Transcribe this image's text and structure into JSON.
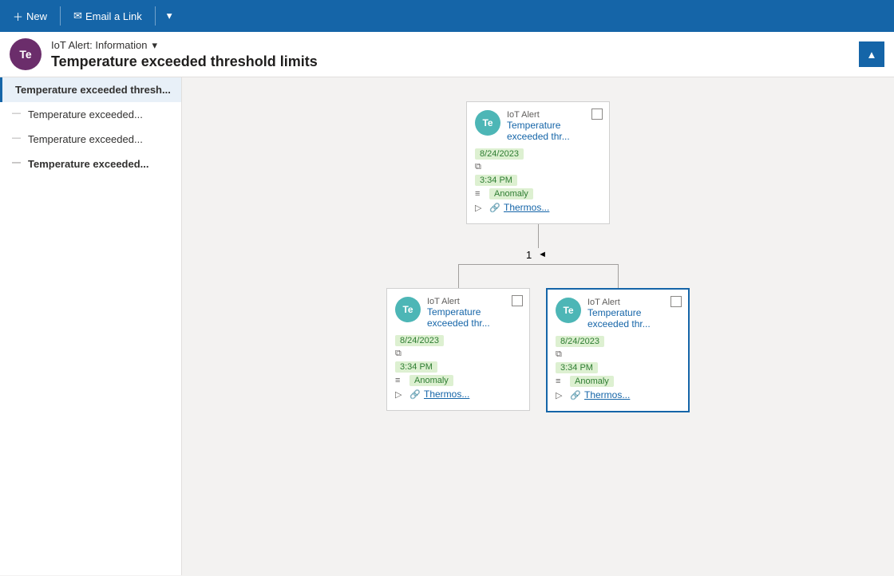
{
  "toolbar": {
    "new_label": "New",
    "email_label": "Email a Link",
    "new_icon": "+",
    "email_icon": "✉"
  },
  "header": {
    "avatar_initials": "Te",
    "avatar_bg": "#6b2d6b",
    "dropdown_label": "IoT Alert: Information",
    "title": "Temperature exceeded threshold limits",
    "collapse_icon": "▲"
  },
  "sidebar": {
    "items": [
      {
        "label": "Temperature exceeded thresh...",
        "type": "parent",
        "state": "active"
      },
      {
        "label": "Temperature exceeded...",
        "type": "child"
      },
      {
        "label": "Temperature exceeded...",
        "type": "child"
      },
      {
        "label": "Temperature exceeded...",
        "type": "child-selected"
      }
    ]
  },
  "tree": {
    "root": {
      "avatar_initials": "Te",
      "card_type": "IoT Alert",
      "title": "Temperature exceeded thr...",
      "date": "8/24/2023",
      "time": "3:34 PM",
      "category": "Anomaly",
      "link": "Thermos...",
      "checkbox": false
    },
    "pagination": {
      "page": "1",
      "back_icon": "◄"
    },
    "children": [
      {
        "avatar_initials": "Te",
        "card_type": "IoT Alert",
        "title": "Temperature exceeded thr...",
        "date": "8/24/2023",
        "time": "3:34 PM",
        "category": "Anomaly",
        "link": "Thermos...",
        "selected": false
      },
      {
        "avatar_initials": "Te",
        "card_type": "IoT Alert",
        "title": "Temperature exceeded thr...",
        "date": "8/24/2023",
        "time": "3:34 PM",
        "category": "Anomaly",
        "link": "Thermos...",
        "selected": true
      }
    ]
  },
  "icons": {
    "calendar": "📅",
    "copy": "⧉",
    "tag": "🏷",
    "link": "🔗",
    "arrow": "▷"
  }
}
